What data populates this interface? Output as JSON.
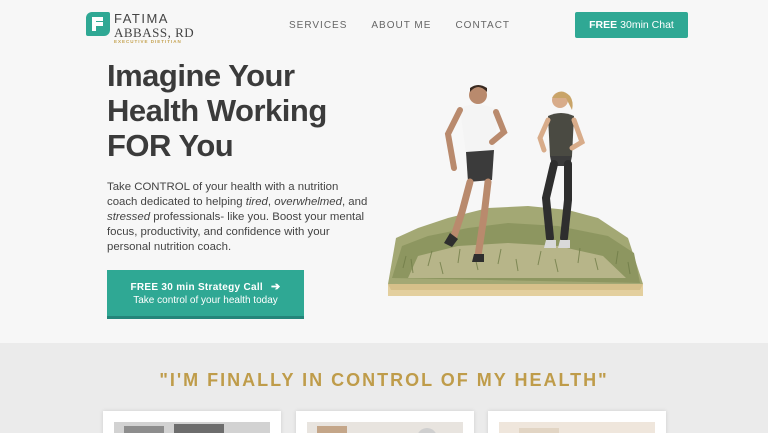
{
  "brand": {
    "name_line1": "FATIMA",
    "name_line2": "ABBASS, RD",
    "tagline": "EXECUTIVE DIETITIAN",
    "accent_color": "#2fa894",
    "gold_color": "#bf9c4a"
  },
  "nav": {
    "items": [
      "SERVICES",
      "ABOUT ME",
      "CONTACT"
    ],
    "cta_bold": "FREE",
    "cta_rest": "30min Chat"
  },
  "hero": {
    "title_lines": [
      "Imagine Your",
      "Health Working",
      "FOR You"
    ],
    "desc_parts": {
      "a": "Take CONTROL of your health with a nutrition coach dedicated to helping ",
      "b": "tired",
      "c": ", ",
      "d": "overwhelmed",
      "e": ", and ",
      "f": "stressed",
      "g": " professionals- like you. Boost your mental focus, productivity, and confidence with your personal nutrition coach."
    },
    "cta_main": "FREE 30 min Strategy Call",
    "cta_arrow_icon": "arrow-right-icon",
    "cta_sub": "Take control of your health today"
  },
  "testimonials": {
    "quote": "\"I'M FINALLY IN CONTROL OF MY HEALTH\""
  }
}
